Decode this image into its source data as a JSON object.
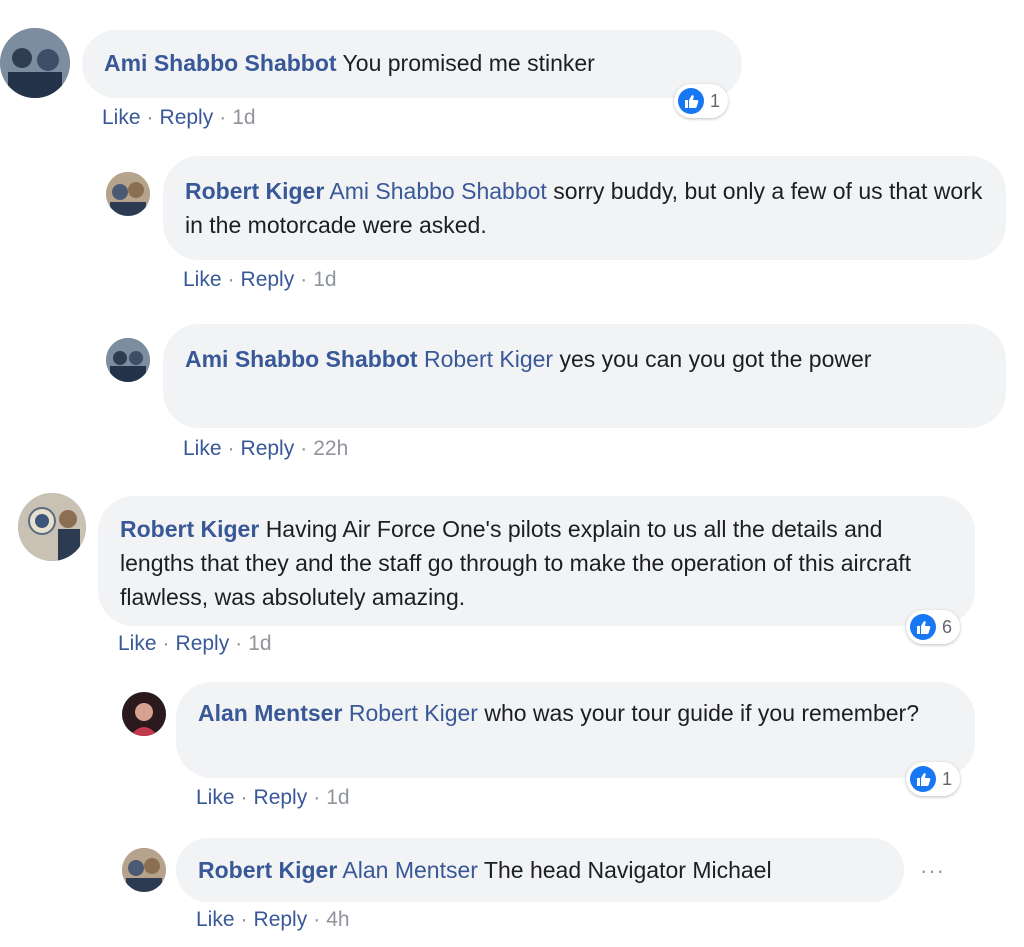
{
  "comments": [
    {
      "author": "Ami Shabbo Shabbot",
      "mention": "",
      "text": "You promised me stinker",
      "actions": {
        "like": "Like",
        "reply": "Reply",
        "time": "1d"
      },
      "reactions": "1"
    },
    {
      "author": "Robert Kiger",
      "mention": "Ami Shabbo Shabbot",
      "text": "sorry buddy, but only a few of us that work in the motorcade were asked.",
      "actions": {
        "like": "Like",
        "reply": "Reply",
        "time": "1d"
      }
    },
    {
      "author": "Ami Shabbo Shabbot",
      "mention": "Robert Kiger",
      "text": "yes you can you got the power",
      "actions": {
        "like": "Like",
        "reply": "Reply",
        "time": "22h"
      }
    },
    {
      "author": "Robert Kiger",
      "mention": "",
      "text": "Having Air Force One's pilots explain to us all the details and lengths that they and the staff go through to make the operation of this aircraft flawless, was absolutely amazing.",
      "actions": {
        "like": "Like",
        "reply": "Reply",
        "time": "1d"
      },
      "reactions": "6"
    },
    {
      "author": "Alan Mentser",
      "mention": "Robert Kiger",
      "text": "who was your tour guide if you remember?",
      "actions": {
        "like": "Like",
        "reply": "Reply",
        "time": "1d"
      },
      "reactions": "1"
    },
    {
      "author": "Robert Kiger",
      "mention": "Alan Mentser",
      "text": "The head Navigator Michael",
      "actions": {
        "like": "Like",
        "reply": "Reply",
        "time": "4h"
      }
    }
  ],
  "icons": {
    "reaction": "like-thumb-icon",
    "more": "more-options-icon"
  },
  "more_label": "···",
  "colors": {
    "link": "#385898",
    "bubble": "#f2f3f5",
    "like_blue": "#1877f2",
    "meta_gray": "#90949c"
  }
}
